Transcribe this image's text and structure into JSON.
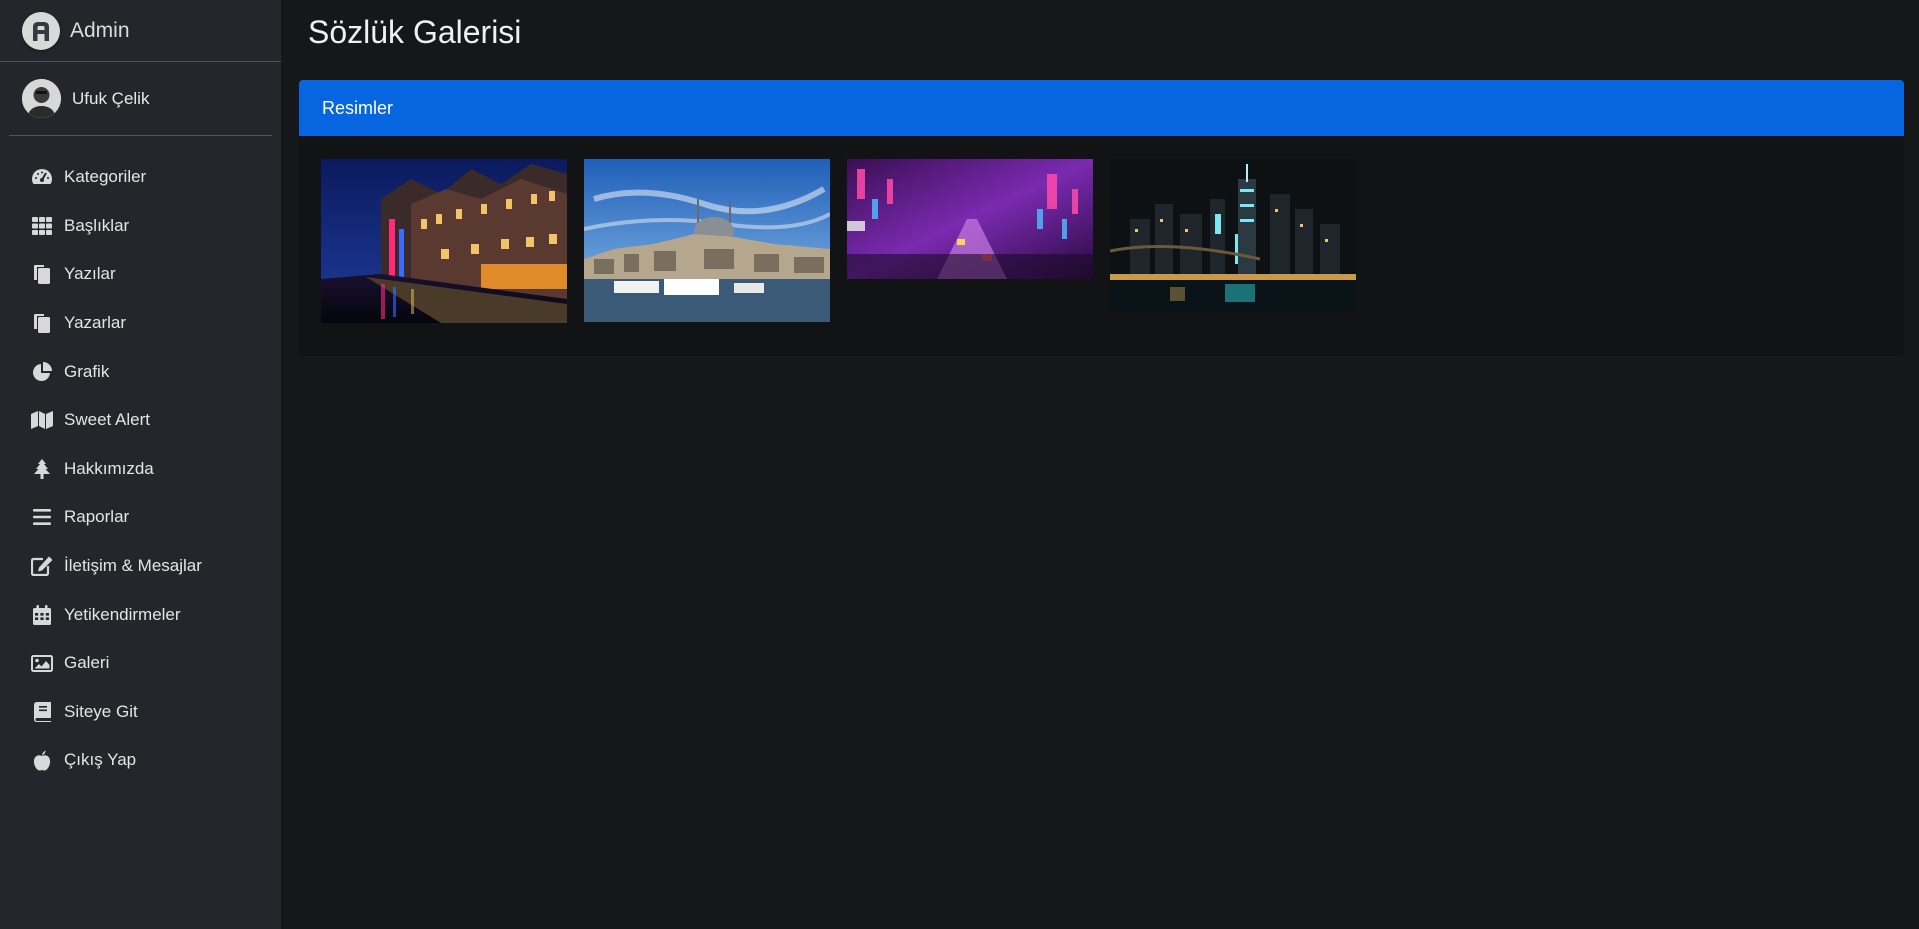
{
  "brand": {
    "name": "Admin"
  },
  "user": {
    "name": "Ufuk Çelik"
  },
  "nav": [
    {
      "label": "Kategoriler",
      "icon": "tachometer-icon"
    },
    {
      "label": "Başlıklar",
      "icon": "grid-icon"
    },
    {
      "label": "Yazılar",
      "icon": "copy-icon"
    },
    {
      "label": "Yazarlar",
      "icon": "copy-icon"
    },
    {
      "label": "Grafik",
      "icon": "pie-chart-icon"
    },
    {
      "label": "Sweet Alert",
      "icon": "map-icon"
    },
    {
      "label": "Hakkımızda",
      "icon": "tree-icon"
    },
    {
      "label": "Raporlar",
      "icon": "bars-icon"
    },
    {
      "label": "İletişim & Mesajlar",
      "icon": "edit-icon"
    },
    {
      "label": "Yetikendirmeler",
      "icon": "calendar-icon"
    },
    {
      "label": "Galeri",
      "icon": "image-icon"
    },
    {
      "label": "Siteye Git",
      "icon": "book-icon"
    },
    {
      "label": "Çıkış Yap",
      "icon": "apple-icon"
    }
  ],
  "page": {
    "title": "Sözlük Galerisi"
  },
  "card": {
    "title": "Resimler"
  },
  "gallery": [
    {
      "subject": "amsterdam-canal-night"
    },
    {
      "subject": "istanbul-mosque-bosphorus"
    },
    {
      "subject": "neon-city-street"
    },
    {
      "subject": "new-york-skyline-bridge"
    }
  ],
  "colors": {
    "sidebar": "#23272b",
    "background": "#151719",
    "card_header": "#0765e0"
  }
}
